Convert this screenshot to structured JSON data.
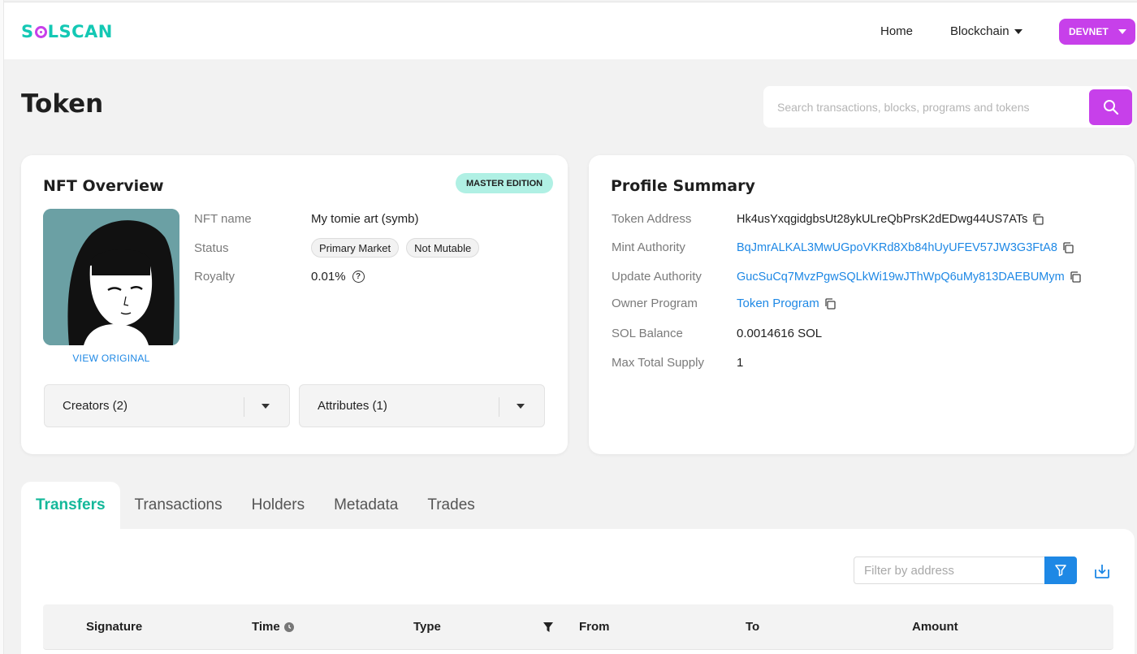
{
  "header": {
    "logo": "SOLSCAN",
    "nav": {
      "home": "Home",
      "blockchain": "Blockchain"
    },
    "network": "DEVNET"
  },
  "page": {
    "title": "Token"
  },
  "search": {
    "placeholder": "Search transactions, blocks, programs and tokens"
  },
  "nft_overview": {
    "title": "NFT Overview",
    "badge": "MASTER EDITION",
    "view_original": "VIEW ORIGINAL",
    "fields": {
      "name_label": "NFT name",
      "name_value": "My tomie art (symb)",
      "status_label": "Status",
      "status_tags": [
        "Primary Market",
        "Not Mutable"
      ],
      "royalty_label": "Royalty",
      "royalty_value": "0.01%"
    },
    "creators": "Creators (2)",
    "attributes": "Attributes (1)"
  },
  "profile_summary": {
    "title": "Profile Summary",
    "rows": [
      {
        "label": "Token Address",
        "value": "Hk4usYxqgidgbsUt28ykULreQbPrsK2dEDwg44US7ATs"
      },
      {
        "label": "Mint Authority",
        "value": "BqJmrALKAL3MwUGpoVKRd8Xb84hUyUFEV57JW3G3FtA8"
      },
      {
        "label": "Update Authority",
        "value": "GucSuCq7MvzPgwSQLkWi19wJThWpQ6uMy813DAEBUMym"
      },
      {
        "label": "Owner Program",
        "value": "Token Program"
      },
      {
        "label": "SOL Balance",
        "value": "0.0014616 SOL"
      },
      {
        "label": "Max Total Supply",
        "value": "1"
      }
    ]
  },
  "tabs": [
    "Transfers",
    "Transactions",
    "Holders",
    "Metadata",
    "Trades"
  ],
  "transfers": {
    "filter_placeholder": "Filter by address",
    "columns": [
      "Signature",
      "Time",
      "Type",
      "From",
      "To",
      "Amount"
    ]
  },
  "colors": {
    "accent": "#c740ea",
    "brand": "#14c8b4",
    "link": "#1e88e5",
    "active_tab": "#14b89a"
  }
}
